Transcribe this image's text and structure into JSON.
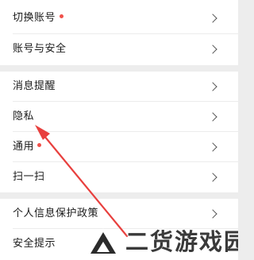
{
  "settings": {
    "group1": {
      "switch_account": {
        "label": "切换账号",
        "has_badge": true
      },
      "account_security": {
        "label": "账号与安全",
        "has_badge": false
      }
    },
    "group2": {
      "notifications": {
        "label": "消息提醒",
        "has_badge": false
      },
      "privacy": {
        "label": "隐私",
        "has_badge": false
      },
      "general": {
        "label": "通用",
        "has_badge": true
      },
      "scan": {
        "label": "扫一扫",
        "has_badge": false
      }
    },
    "group3": {
      "privacy_policy": {
        "label": "个人信息保护政策",
        "has_badge": false
      },
      "security_tips": {
        "label": "安全提示",
        "has_badge": false
      }
    }
  },
  "watermark": {
    "text": "二货游戏园"
  },
  "colors": {
    "badge": "#f0504a",
    "annotation_arrow": "#e8403e",
    "background": "#ededed",
    "row_background": "#ffffff"
  },
  "icons": {
    "chevron": "chevron-right-icon",
    "watermark_logo": "triangle-logo-icon"
  }
}
